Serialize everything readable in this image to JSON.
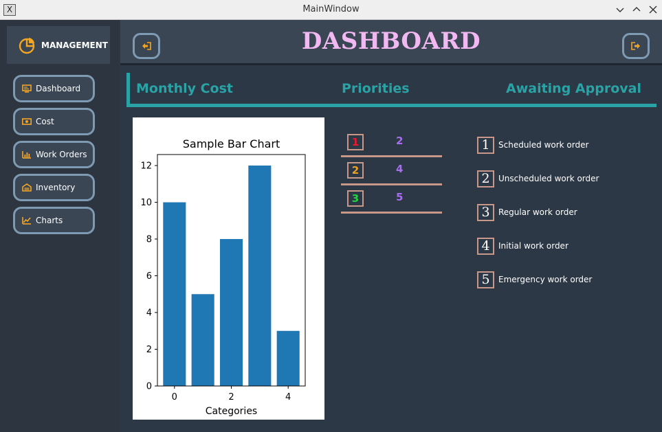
{
  "window": {
    "title": "MainWindow",
    "app_icon": "X"
  },
  "sidebar": {
    "brand_label": "MANAGEMENT",
    "items": [
      {
        "label": "Dashboard",
        "icon": "monitor-icon"
      },
      {
        "label": "Cost",
        "icon": "money-icon"
      },
      {
        "label": "Work Orders",
        "icon": "bar-chart-icon"
      },
      {
        "label": "Inventory",
        "icon": "warehouse-icon"
      },
      {
        "label": "Charts",
        "icon": "line-chart-icon"
      }
    ]
  },
  "header": {
    "title": "DASHBOARD",
    "left_button_icon": "sign-in-icon",
    "right_button_icon": "sign-out-icon"
  },
  "tabs": [
    "Monthly Cost",
    "Priorities",
    "Awaiting Approval"
  ],
  "priorities": [
    {
      "rank": "1",
      "value": "2",
      "color": "#e8192c"
    },
    {
      "rank": "2",
      "value": "4",
      "color": "#f0a020"
    },
    {
      "rank": "3",
      "value": "5",
      "color": "#22d63c"
    }
  ],
  "awaiting": [
    {
      "num": "1",
      "label": "Scheduled work order"
    },
    {
      "num": "2",
      "label": "Unscheduled work order"
    },
    {
      "num": "3",
      "label": "Regular work order"
    },
    {
      "num": "4",
      "label": "Initial work order"
    },
    {
      "num": "5",
      "label": "Emergency work order"
    }
  ],
  "colors": {
    "accent": "#2aa3a6",
    "title_pink": "#f2b8f2",
    "icon_orange": "#f5a623",
    "bar_blue": "#1f77b4"
  },
  "chart_data": {
    "type": "bar",
    "title": "Sample Bar Chart",
    "xlabel": "Categories",
    "ylabel": "",
    "categories": [
      0,
      1,
      2,
      3,
      4
    ],
    "values": [
      10,
      5,
      8,
      12,
      3
    ],
    "xticks": [
      "0",
      "2",
      "4"
    ],
    "yticks": [
      "0",
      "2",
      "4",
      "6",
      "8",
      "10",
      "12"
    ],
    "ylim": [
      0,
      12.6
    ],
    "grid": false
  }
}
